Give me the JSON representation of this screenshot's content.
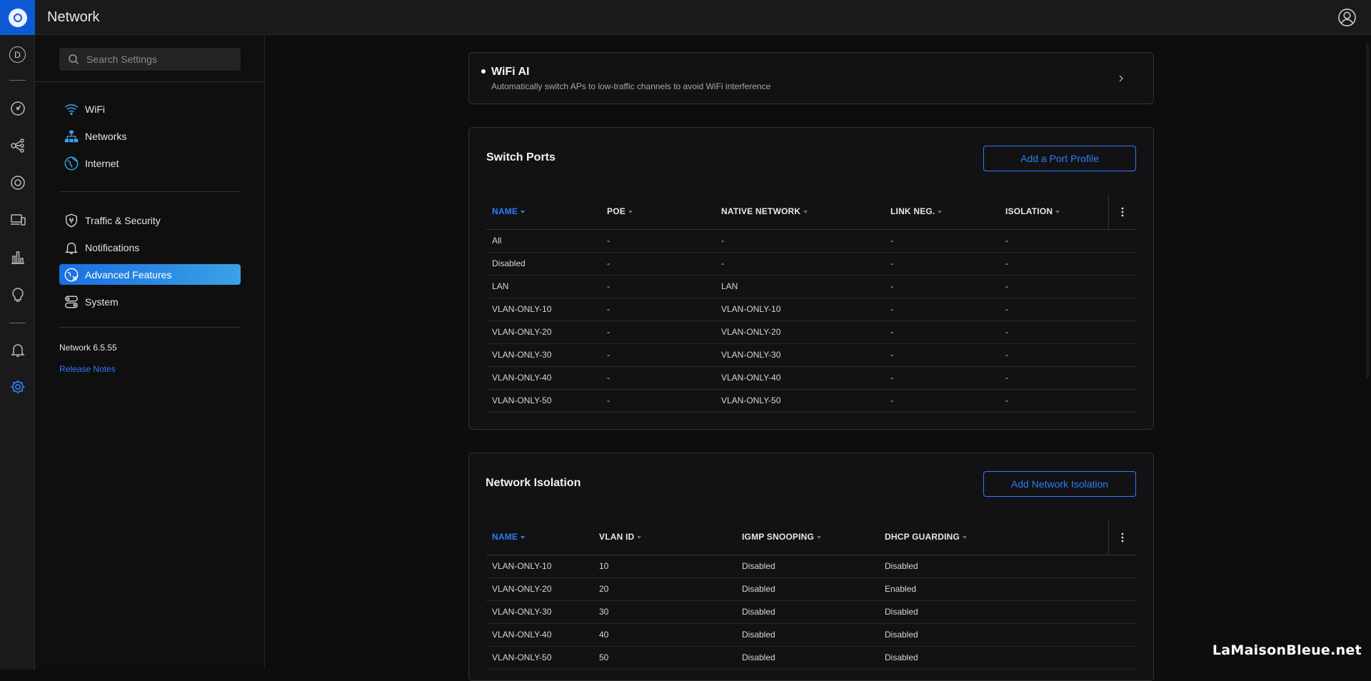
{
  "app": {
    "title": "Network"
  },
  "search": {
    "placeholder": "Search Settings"
  },
  "sidebar": {
    "items": [
      {
        "label": "WiFi",
        "icon": "wifi-icon"
      },
      {
        "label": "Networks",
        "icon": "networks-icon"
      },
      {
        "label": "Internet",
        "icon": "globe-icon"
      },
      {
        "label": "Traffic & Security",
        "icon": "shield-icon"
      },
      {
        "label": "Notifications",
        "icon": "bell-icon"
      },
      {
        "label": "Advanced Features",
        "icon": "advanced-features-icon",
        "active": true
      },
      {
        "label": "System",
        "icon": "system-icon"
      }
    ],
    "version": "Network 6.5.55",
    "release_notes": "Release Notes"
  },
  "rail": {
    "avatar_letter": "D",
    "icons": [
      "dashboard-icon",
      "topology-icon",
      "devices-icon",
      "clients-icon",
      "statistics-icon",
      "insights-icon",
      "alerts-icon",
      "settings-icon"
    ]
  },
  "wifi_ai": {
    "title": "WiFi AI",
    "description": "Automatically switch APs to low-traffic channels to avoid WiFi interference"
  },
  "switch_ports": {
    "title": "Switch Ports",
    "button": "Add a Port Profile",
    "columns": [
      "NAME",
      "POE",
      "NATIVE NETWORK",
      "LINK NEG.",
      "ISOLATION"
    ],
    "rows": [
      [
        "All",
        "-",
        "-",
        "-",
        "-"
      ],
      [
        "Disabled",
        "-",
        "-",
        "-",
        "-"
      ],
      [
        "LAN",
        "-",
        "LAN",
        "-",
        "-"
      ],
      [
        "VLAN-ONLY-10",
        "-",
        "VLAN-ONLY-10",
        "-",
        "-"
      ],
      [
        "VLAN-ONLY-20",
        "-",
        "VLAN-ONLY-20",
        "-",
        "-"
      ],
      [
        "VLAN-ONLY-30",
        "-",
        "VLAN-ONLY-30",
        "-",
        "-"
      ],
      [
        "VLAN-ONLY-40",
        "-",
        "VLAN-ONLY-40",
        "-",
        "-"
      ],
      [
        "VLAN-ONLY-50",
        "-",
        "VLAN-ONLY-50",
        "-",
        "-"
      ]
    ]
  },
  "network_isolation": {
    "title": "Network Isolation",
    "button": "Add Network Isolation",
    "columns": [
      "NAME",
      "VLAN ID",
      "IGMP SNOOPING",
      "DHCP GUARDING"
    ],
    "rows": [
      [
        "VLAN-ONLY-10",
        "10",
        "Disabled",
        "Disabled"
      ],
      [
        "VLAN-ONLY-20",
        "20",
        "Disabled",
        "Enabled"
      ],
      [
        "VLAN-ONLY-30",
        "30",
        "Disabled",
        "Disabled"
      ],
      [
        "VLAN-ONLY-40",
        "40",
        "Disabled",
        "Disabled"
      ],
      [
        "VLAN-ONLY-50",
        "50",
        "Disabled",
        "Disabled"
      ]
    ]
  },
  "watermark": "LaMaisonBleue.net",
  "colors": {
    "accent": "#2f7bf5",
    "active_start": "#1a6fe0",
    "active_end": "#3aa2e6",
    "rail_logo": "#0e5ad6"
  }
}
